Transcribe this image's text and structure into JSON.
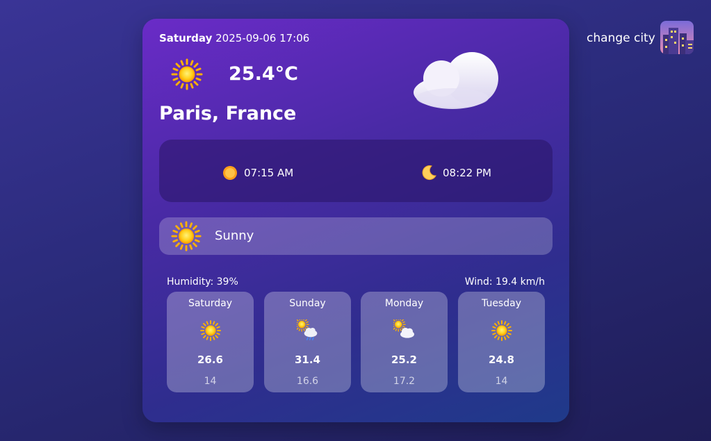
{
  "header": {
    "day": "Saturday",
    "datetime": "2025-09-06 17:06"
  },
  "current": {
    "temperature": "25.4°C",
    "location": "Paris, France",
    "icon": "sun-icon",
    "cloud_icon": "cloud-icon"
  },
  "sun": {
    "sunrise": "07:15 AM",
    "sunset": "08:22 PM"
  },
  "condition": {
    "label": "Sunny",
    "icon": "sun-icon"
  },
  "stats": {
    "humidity": "Humidity: 39%",
    "wind": "Wind: 19.4 km/h"
  },
  "forecast": [
    {
      "day": "Saturday",
      "high": "26.6",
      "low": "14",
      "icon": "sun-icon"
    },
    {
      "day": "Sunday",
      "high": "31.4",
      "low": "16.6",
      "icon": "sun-cloud-rain-icon"
    },
    {
      "day": "Monday",
      "high": "25.2",
      "low": "17.2",
      "icon": "sun-cloud-icon"
    },
    {
      "day": "Tuesday",
      "high": "24.8",
      "low": "14",
      "icon": "sun-icon"
    }
  ],
  "nav": {
    "change_city": "change city",
    "icon": "city-icon"
  },
  "colors": {
    "sun": "#ffc107",
    "sun_core": "#ffb300",
    "card_top": "#6a2bc7",
    "card_bottom": "#1f3a8a"
  }
}
